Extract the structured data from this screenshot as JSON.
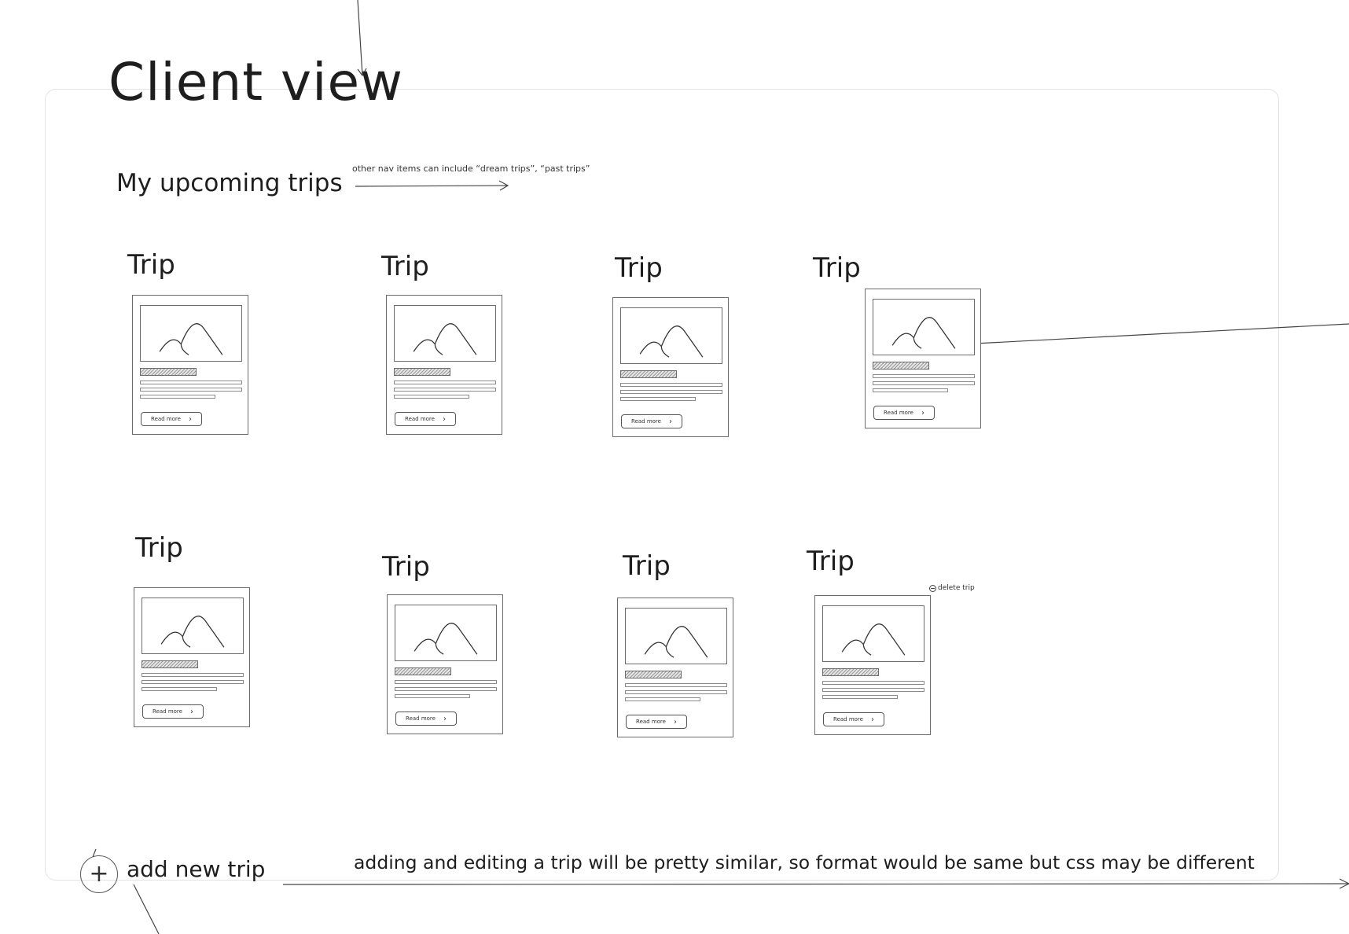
{
  "page_title": "Client view",
  "section_title": "My upcoming trips",
  "nav_note": "other nav items can include “dream trips”, “past trips”",
  "trips": [
    {
      "title": "Trip",
      "button_label": "Read more"
    },
    {
      "title": "Trip",
      "button_label": "Read more"
    },
    {
      "title": "Trip",
      "button_label": "Read more"
    },
    {
      "title": "Trip",
      "button_label": "Read more"
    },
    {
      "title": "Trip",
      "button_label": "Read more"
    },
    {
      "title": "Trip",
      "button_label": "Read more"
    },
    {
      "title": "Trip",
      "button_label": "Read more"
    },
    {
      "title": "Trip",
      "button_label": "Read more"
    }
  ],
  "delete_label": "delete trip",
  "add_label": "add new trip",
  "bottom_note": "adding and editing a trip will be pretty similar, so format would be same but css may be different",
  "colors": {
    "stroke": "#1e1e1e",
    "frame": "#e3e3e3",
    "hatch": "#9a9a9a"
  }
}
